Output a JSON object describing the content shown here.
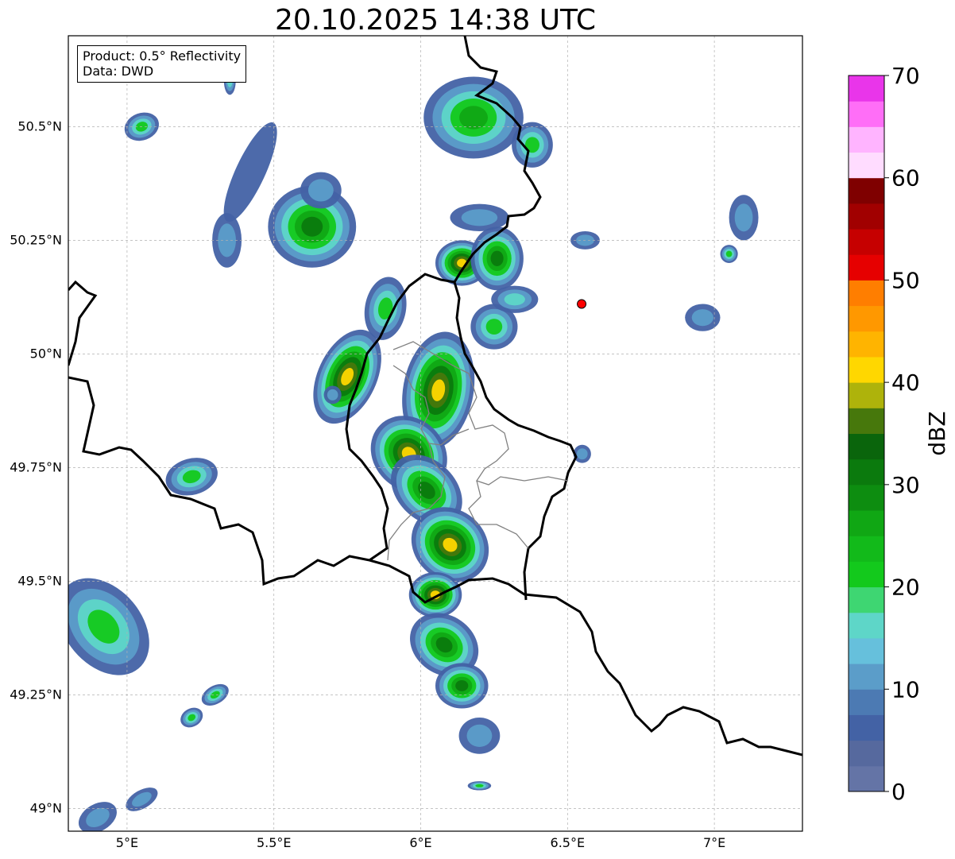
{
  "title": "20.10.2025 14:38 UTC",
  "info": {
    "product": "Product: 0.5° Reflectivity",
    "data": "Data: DWD"
  },
  "map": {
    "lon_range": [
      4.8,
      7.3
    ],
    "lat_range": [
      48.95,
      50.7
    ],
    "x_ticks": [
      {
        "value": 5.0,
        "label": "5°E"
      },
      {
        "value": 5.5,
        "label": "5.5°E"
      },
      {
        "value": 6.0,
        "label": "6°E"
      },
      {
        "value": 6.5,
        "label": "6.5°E"
      },
      {
        "value": 7.0,
        "label": "7°E"
      }
    ],
    "y_ticks": [
      {
        "value": 50.5,
        "label": "50.5°N"
      },
      {
        "value": 50.25,
        "label": "50.25°N"
      },
      {
        "value": 50.0,
        "label": "50°N"
      },
      {
        "value": 49.75,
        "label": "49.75°N"
      },
      {
        "value": 49.5,
        "label": "49.5°N"
      },
      {
        "value": 49.25,
        "label": "49.25°N"
      },
      {
        "value": 49.0,
        "label": "49°N"
      }
    ],
    "gridlines": true,
    "radar_site": {
      "lon": 6.548,
      "lat": 50.11,
      "color": "#ff0000"
    }
  },
  "colorbar": {
    "label": "dBZ",
    "range": [
      0,
      70
    ],
    "tick_labels": [
      {
        "value": 0,
        "label": "0"
      },
      {
        "value": 10,
        "label": "10"
      },
      {
        "value": 20,
        "label": "20"
      },
      {
        "value": 30,
        "label": "30"
      },
      {
        "value": 40,
        "label": "40"
      },
      {
        "value": 50,
        "label": "50"
      },
      {
        "value": 60,
        "label": "60"
      },
      {
        "value": 70,
        "label": "70"
      }
    ],
    "colors": [
      "#6474a6",
      "#56699e",
      "#4362a5",
      "#4c7ab3",
      "#5b9dc9",
      "#66c0dc",
      "#5ed6c8",
      "#3ed672",
      "#13c91c",
      "#12ba1a",
      "#10a714",
      "#0d8d10",
      "#0b7a0d",
      "#0a650c",
      "#47780c",
      "#aeb30b",
      "#ffd700",
      "#ffb400",
      "#ff9800",
      "#ff7e00",
      "#e60000",
      "#c60000",
      "#a10000",
      "#7f0000",
      "#ffdcff",
      "#ffb4ff",
      "#ff6ef7",
      "#e935ea"
    ]
  },
  "cells": [
    {
      "lon": 6.18,
      "lat": 50.52,
      "rx": 0.17,
      "ry": 0.09,
      "rot": 0,
      "core": 28
    },
    {
      "lon": 6.38,
      "lat": 50.46,
      "rx": 0.07,
      "ry": 0.05,
      "rot": 0,
      "core": 20
    },
    {
      "lon": 5.63,
      "lat": 50.28,
      "rx": 0.15,
      "ry": 0.09,
      "rot": 0,
      "core": 30
    },
    {
      "lon": 5.66,
      "lat": 50.36,
      "rx": 0.07,
      "ry": 0.04,
      "rot": 0,
      "core": 12
    },
    {
      "lon": 5.42,
      "lat": 50.4,
      "rx": 0.05,
      "ry": 0.12,
      "rot": 25,
      "core": 8
    },
    {
      "lon": 5.34,
      "lat": 50.25,
      "rx": 0.05,
      "ry": 0.06,
      "rot": 0,
      "core": 10
    },
    {
      "lon": 5.05,
      "lat": 50.5,
      "rx": 0.06,
      "ry": 0.03,
      "rot": -20,
      "core": 22
    },
    {
      "lon": 6.14,
      "lat": 50.2,
      "rx": 0.09,
      "ry": 0.05,
      "rot": 0,
      "core": 40
    },
    {
      "lon": 6.26,
      "lat": 50.21,
      "rx": 0.09,
      "ry": 0.07,
      "rot": 0,
      "core": 30
    },
    {
      "lon": 6.2,
      "lat": 50.3,
      "rx": 0.1,
      "ry": 0.03,
      "rot": 0,
      "core": 12
    },
    {
      "lon": 5.88,
      "lat": 50.1,
      "rx": 0.07,
      "ry": 0.07,
      "rot": 10,
      "core": 22
    },
    {
      "lon": 5.75,
      "lat": 49.95,
      "rx": 0.1,
      "ry": 0.11,
      "rot": 25,
      "core": 40
    },
    {
      "lon": 6.06,
      "lat": 49.92,
      "rx": 0.12,
      "ry": 0.13,
      "rot": 10,
      "core": 44
    },
    {
      "lon": 5.96,
      "lat": 49.78,
      "rx": 0.12,
      "ry": 0.09,
      "rot": -45,
      "core": 40
    },
    {
      "lon": 6.02,
      "lat": 49.7,
      "rx": 0.1,
      "ry": 0.09,
      "rot": -45,
      "core": 30
    },
    {
      "lon": 6.1,
      "lat": 49.58,
      "rx": 0.12,
      "ry": 0.09,
      "rot": -50,
      "core": 40
    },
    {
      "lon": 6.05,
      "lat": 49.47,
      "rx": 0.09,
      "ry": 0.05,
      "rot": 0,
      "core": 40
    },
    {
      "lon": 6.08,
      "lat": 49.36,
      "rx": 0.1,
      "ry": 0.08,
      "rot": -55,
      "core": 32
    },
    {
      "lon": 6.14,
      "lat": 49.27,
      "rx": 0.09,
      "ry": 0.05,
      "rot": 0,
      "core": 30
    },
    {
      "lon": 6.2,
      "lat": 49.16,
      "rx": 0.07,
      "ry": 0.04,
      "rot": 0,
      "core": 14
    },
    {
      "lon": 6.25,
      "lat": 50.06,
      "rx": 0.08,
      "ry": 0.05,
      "rot": 0,
      "core": 24
    },
    {
      "lon": 6.32,
      "lat": 50.12,
      "rx": 0.08,
      "ry": 0.03,
      "rot": 0,
      "core": 16
    },
    {
      "lon": 5.22,
      "lat": 49.73,
      "rx": 0.09,
      "ry": 0.04,
      "rot": -15,
      "core": 22
    },
    {
      "lon": 4.92,
      "lat": 49.4,
      "rx": 0.13,
      "ry": 0.12,
      "rot": -40,
      "core": 24
    },
    {
      "lon": 7.1,
      "lat": 50.3,
      "rx": 0.05,
      "ry": 0.05,
      "rot": 0,
      "core": 10
    },
    {
      "lon": 7.05,
      "lat": 50.22,
      "rx": 0.03,
      "ry": 0.02,
      "rot": 0,
      "core": 20
    },
    {
      "lon": 6.96,
      "lat": 50.08,
      "rx": 0.06,
      "ry": 0.03,
      "rot": 0,
      "core": 12
    },
    {
      "lon": 6.56,
      "lat": 50.25,
      "rx": 0.05,
      "ry": 0.02,
      "rot": 0,
      "core": 10
    },
    {
      "lon": 5.3,
      "lat": 49.25,
      "rx": 0.05,
      "ry": 0.02,
      "rot": -30,
      "core": 20
    },
    {
      "lon": 5.22,
      "lat": 49.2,
      "rx": 0.04,
      "ry": 0.02,
      "rot": -30,
      "core": 22
    },
    {
      "lon": 5.05,
      "lat": 49.02,
      "rx": 0.06,
      "ry": 0.02,
      "rot": -30,
      "core": 12
    },
    {
      "lon": 4.9,
      "lat": 48.98,
      "rx": 0.07,
      "ry": 0.03,
      "rot": -30,
      "core": 12
    },
    {
      "lon": 6.55,
      "lat": 49.78,
      "rx": 0.03,
      "ry": 0.02,
      "rot": 0,
      "core": 12
    },
    {
      "lon": 5.35,
      "lat": 50.6,
      "rx": 0.02,
      "ry": 0.03,
      "rot": 0,
      "core": 18
    },
    {
      "lon": 5.7,
      "lat": 49.91,
      "rx": 0.03,
      "ry": 0.02,
      "rot": 0,
      "core": 10
    },
    {
      "lon": 6.2,
      "lat": 49.05,
      "rx": 0.04,
      "ry": 0.01,
      "rot": 0,
      "core": 20
    }
  ]
}
